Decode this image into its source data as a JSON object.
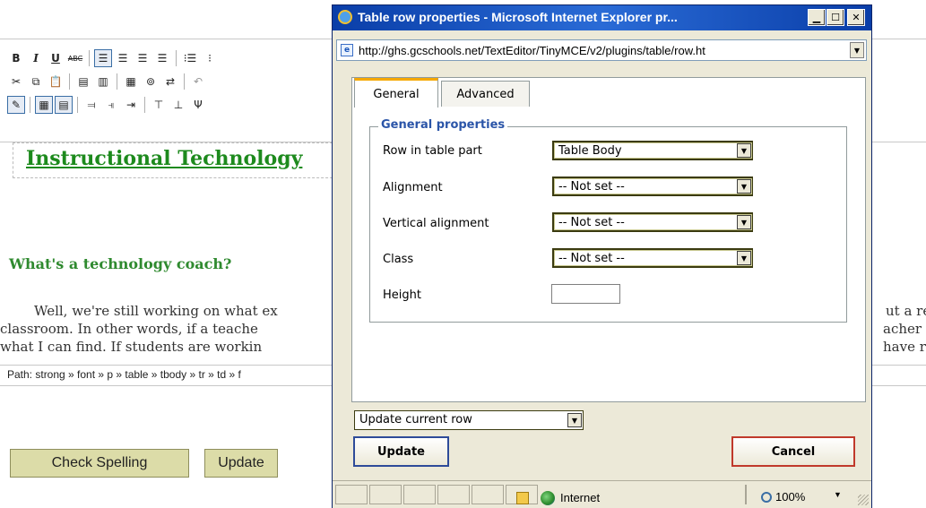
{
  "toolbar": {
    "row1": [
      "B",
      "I",
      "U",
      "ABC",
      "align-left",
      "align-center",
      "align-right",
      "align-justify",
      "bullet-list",
      "numbered-list"
    ],
    "row2": [
      "cut",
      "copy",
      "paste",
      "paste-text",
      "paste-word",
      "select-all",
      "find",
      "replace",
      "undo"
    ],
    "row3": [
      "edit-css",
      "table",
      "table-props",
      "row-before",
      "row-after",
      "delete-row",
      "col-before",
      "col-after",
      "delete-col"
    ]
  },
  "document": {
    "title": "Instructional Technology",
    "heading": "What's a technology coach?",
    "line1_left": "Well, we're still working on what ex",
    "line1_right": "ut a re",
    "line2_left": "classroom.  In other words, if a teache",
    "line2_right": "acher",
    "line3_left": "what I can find.  If students are workin",
    "line3_right": "have r"
  },
  "path_bar": "Path: strong » font » p » table » tbody » tr » td » f",
  "page_buttons": {
    "check_spelling": "Check Spelling",
    "update": "Update"
  },
  "popup": {
    "title": "Table row properties - Microsoft Internet Explorer pr...",
    "url": "http://ghs.gcschools.net/TextEditor/TinyMCE/v2/plugins/table/row.ht",
    "tabs": [
      "General",
      "Advanced"
    ],
    "legend": "General properties",
    "fields": {
      "row_in_table_part": {
        "label": "Row in table part",
        "value": "Table Body"
      },
      "alignment": {
        "label": "Alignment",
        "value": "-- Not set --"
      },
      "vertical_alignment": {
        "label": "Vertical alignment",
        "value": "-- Not set --"
      },
      "class": {
        "label": "Class",
        "value": "-- Not set --"
      },
      "height": {
        "label": "Height",
        "value": ""
      }
    },
    "action_select": "Update current row",
    "update_label": "Update",
    "cancel_label": "Cancel",
    "status": {
      "zone": "Internet",
      "zoom": "100%"
    }
  },
  "colors": {
    "doc_title": "#1d8a1d",
    "legend": "#2b55a8",
    "titlebar": "#0a3ea8",
    "page_button_bg": "#dcdca8"
  }
}
